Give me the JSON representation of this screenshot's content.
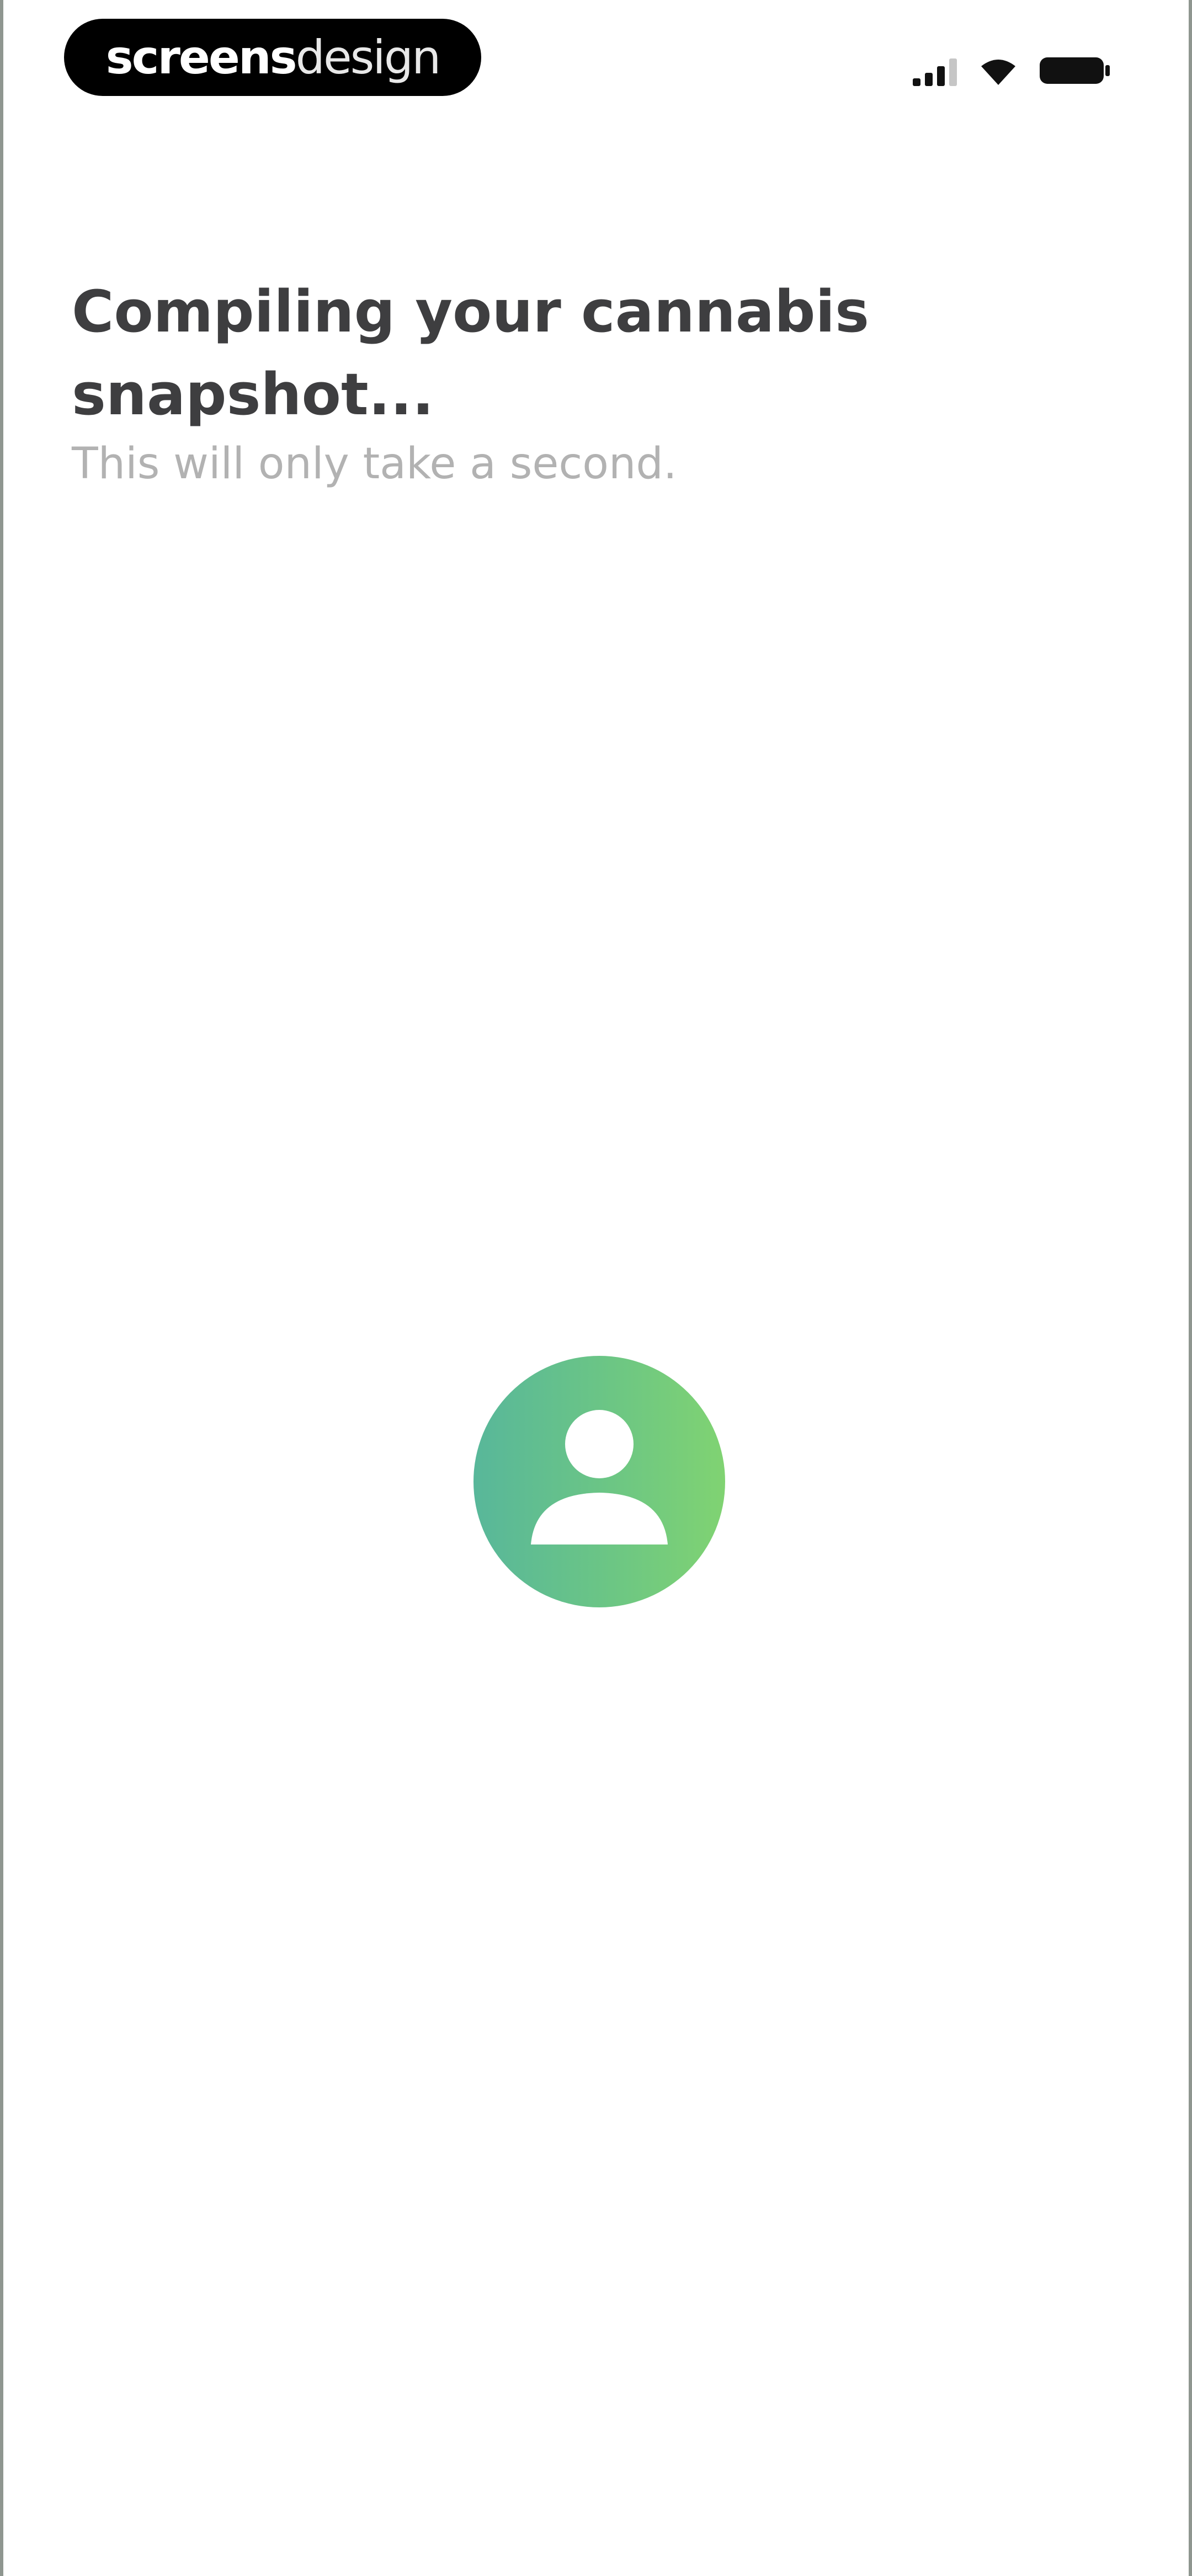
{
  "brand": {
    "part1": "screens",
    "part2": "design"
  },
  "status_bar": {
    "icons": [
      "signal-icon",
      "wifi-icon",
      "battery-icon"
    ]
  },
  "loading": {
    "title": "Compiling your cannabis snapshot...",
    "subtitle": "This will only take a second."
  },
  "avatar": {
    "icon": "user-icon",
    "gradient_start": "#58b79a",
    "gradient_end": "#80d372"
  },
  "colors": {
    "title": "#3e3e40",
    "subtitle": "#b2b2b2",
    "background": "#ffffff"
  }
}
